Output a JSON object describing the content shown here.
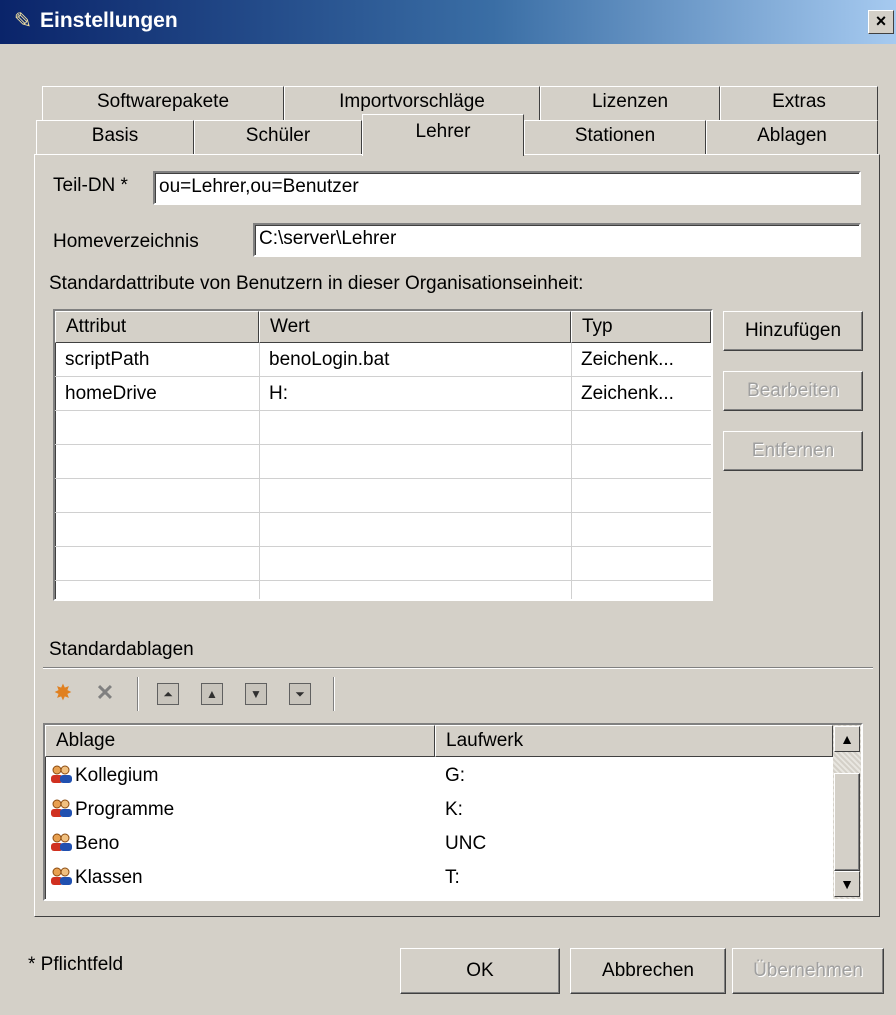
{
  "window": {
    "title": "Einstellungen",
    "close": "×"
  },
  "tabs": {
    "row1": [
      "Softwarepakete",
      "Importvorschläge",
      "Lizenzen",
      "Extras"
    ],
    "row2": [
      "Basis",
      "Schüler",
      "Lehrer",
      "Stationen",
      "Ablagen"
    ],
    "active": "Lehrer"
  },
  "form": {
    "teil_dn_label": "Teil-DN *",
    "teil_dn_value": "ou=Lehrer,ou=Benutzer",
    "home_label": "Homeverzeichnis",
    "home_value": "C:\\server\\Lehrer",
    "attributes_caption": "Standardattribute von Benutzern in dieser Organisationseinheit:"
  },
  "attributes_table": {
    "columns": [
      "Attribut",
      "Wert",
      "Typ"
    ],
    "rows": [
      {
        "attribut": "scriptPath",
        "wert": "benoLogin.bat",
        "typ": "Zeichenk..."
      },
      {
        "attribut": "homeDrive",
        "wert": "H:",
        "typ": "Zeichenk..."
      }
    ]
  },
  "attribute_buttons": {
    "add": "Hinzufügen",
    "edit": "Bearbeiten",
    "remove": "Entfernen"
  },
  "ablagen": {
    "caption": "Standardablagen",
    "columns": [
      "Ablage",
      "Laufwerk"
    ],
    "rows": [
      {
        "name": "Kollegium",
        "drive": "G:"
      },
      {
        "name": "Programme",
        "drive": "K:"
      },
      {
        "name": "Beno",
        "drive": "UNC"
      },
      {
        "name": "Klassen",
        "drive": "T:"
      }
    ]
  },
  "footer": {
    "required_note": "* Pflichtfeld",
    "ok": "OK",
    "cancel": "Abbrechen",
    "apply": "Übernehmen"
  }
}
